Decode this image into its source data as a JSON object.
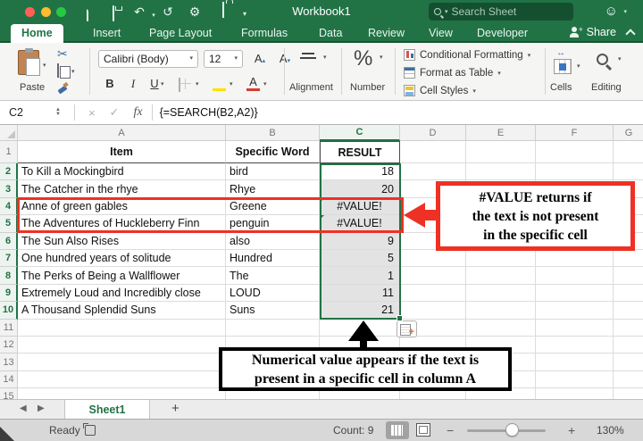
{
  "window": {
    "title": "Workbook1"
  },
  "toolbar": {
    "search_placeholder": "Search Sheet"
  },
  "tabs": {
    "items": [
      "Home",
      "Insert",
      "Page Layout",
      "Formulas",
      "Data",
      "Review",
      "View",
      "Developer"
    ],
    "share": "Share"
  },
  "ribbon": {
    "paste": "Paste",
    "font_name": "Calibri (Body)",
    "font_size": "12",
    "bold": "B",
    "italic": "I",
    "underline": "U",
    "grow_font": "A",
    "shrink_font": "A",
    "font_color_glyph": "A",
    "alignment": "Alignment",
    "number": "Number",
    "percent": "%",
    "conditional_formatting": "Conditional Formatting",
    "format_as_table": "Format as Table",
    "cell_styles": "Cell Styles",
    "cells": "Cells",
    "editing": "Editing"
  },
  "formula_bar": {
    "cell_ref": "C2",
    "fx": "fx",
    "formula": "{=SEARCH(B2,A2)}"
  },
  "grid": {
    "columns": [
      "A",
      "B",
      "C",
      "D",
      "E",
      "F",
      "G"
    ],
    "visible_row_count": 15,
    "headers": {
      "item": "Item",
      "word": "Specific Word",
      "result": "RESULT"
    },
    "rows": [
      {
        "item": "To Kill a Mockingbird",
        "word": "bird",
        "result": "18"
      },
      {
        "item": "The Catcher in the rhye",
        "word": "Rhye",
        "result": "20"
      },
      {
        "item": "Anne of green gables",
        "word": "Greene",
        "result": "#VALUE!"
      },
      {
        "item": "The Adventures of Huckleberry Finn",
        "word": "penguin",
        "result": "#VALUE!"
      },
      {
        "item": "The Sun Also Rises",
        "word": "also",
        "result": "9"
      },
      {
        "item": "One hundred years of solitude",
        "word": "Hundred",
        "result": "5"
      },
      {
        "item": "The Perks of Being a Wallflower",
        "word": "The",
        "result": "1"
      },
      {
        "item": "Extremely Loud and Incredibly close",
        "word": "LOUD",
        "result": "11"
      },
      {
        "item": "A Thousand Splendid Suns",
        "word": "Suns",
        "result": "21"
      }
    ],
    "active_cell": "C2",
    "selected_range": "C2:C10"
  },
  "annotations": {
    "red_lines": [
      "#VALUE returns if",
      "the text is not present",
      "in the specific cell"
    ],
    "black_lines": [
      "Numerical value appears if the text is",
      "present in a specific cell in column A"
    ]
  },
  "sheet_bar": {
    "active_tab": "Sheet1",
    "add_tab": "+"
  },
  "status_bar": {
    "mode": "Ready",
    "count": "Count: 9",
    "zoom_out": "−",
    "zoom_in": "+",
    "zoom_level": "130%"
  },
  "colors": {
    "excel_green": "#217346",
    "annotation_red": "#ee3124",
    "selection_fill": "#e3e3e3"
  }
}
